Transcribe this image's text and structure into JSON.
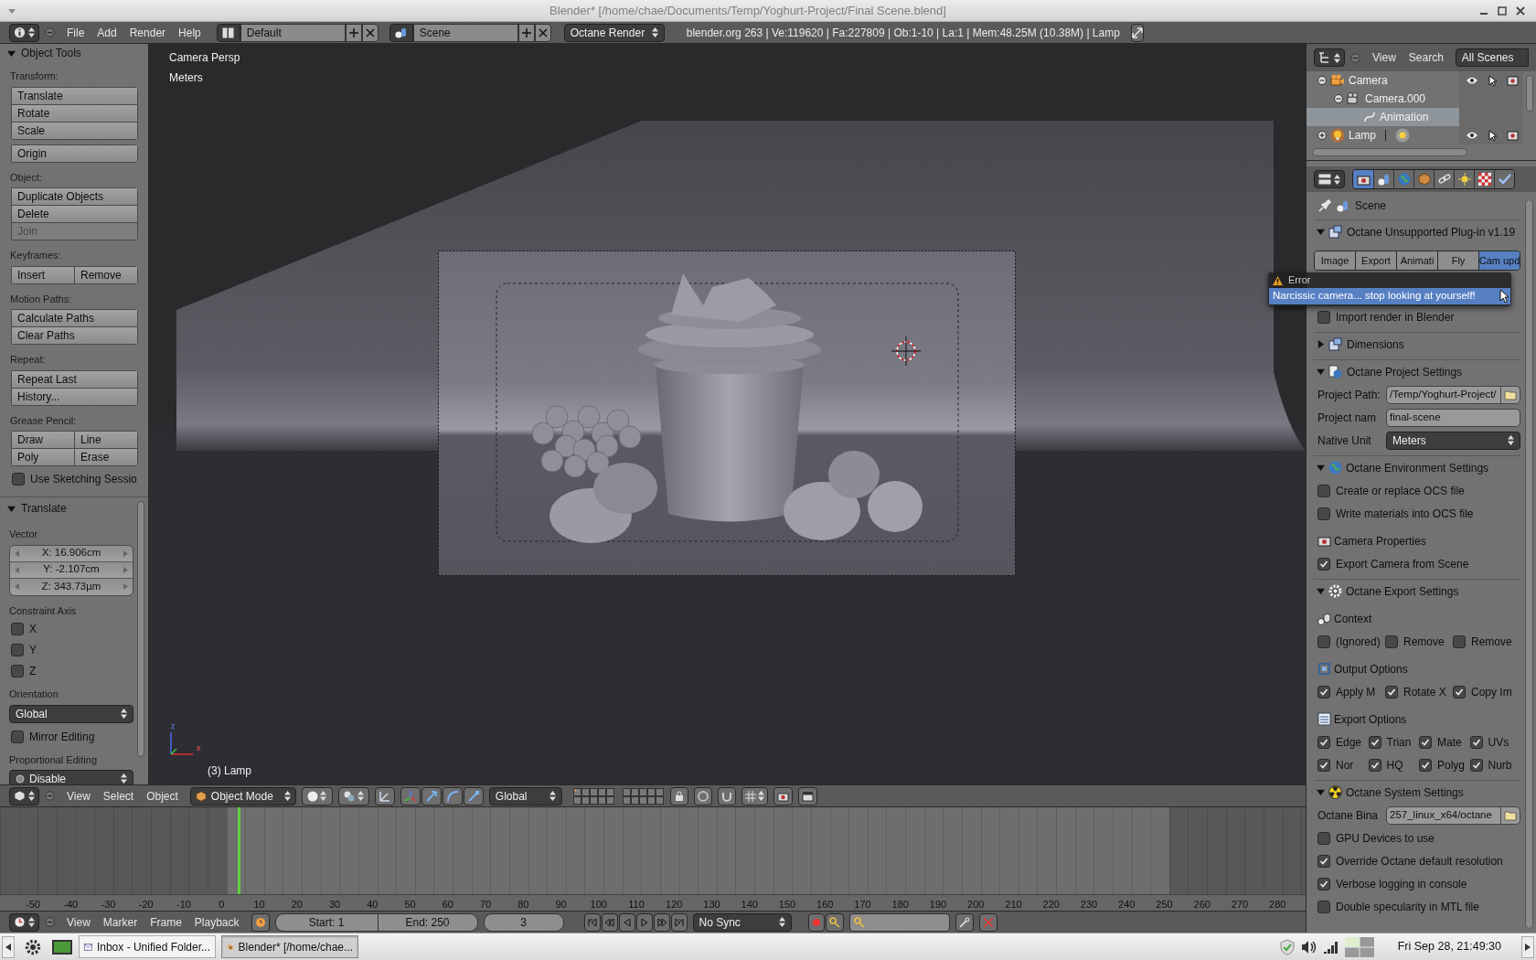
{
  "window": {
    "title": "Blender* [/home/chae/Documents/Temp/Yoghurt-Project/Final Scene.blend]"
  },
  "info_header": {
    "menus": [
      "File",
      "Add",
      "Render",
      "Help"
    ],
    "layout": "Default",
    "scene": "Scene",
    "engine": "Octane Render",
    "stats": "blender.org 263 | Ve:119620 | Fa:227809 | Ob:1-10 | La:1 | Mem:48.25M (10.38M) | Lamp"
  },
  "tool_shelf": {
    "title": "Object Tools",
    "expanded": true,
    "groups": [
      {
        "label": "Transform:",
        "rows": [
          [
            {
              "label": "Translate",
              "disabled": false
            }
          ],
          [
            {
              "label": "Rotate",
              "disabled": false
            }
          ],
          [
            {
              "label": "Scale",
              "disabled": false
            }
          ]
        ]
      },
      {
        "rows": [
          [
            {
              "label": "Origin",
              "disabled": false
            }
          ]
        ]
      },
      {
        "label": "Object:",
        "rows": [
          [
            {
              "label": "Duplicate Objects",
              "disabled": false
            }
          ],
          [
            {
              "label": "Delete",
              "disabled": false
            }
          ],
          [
            {
              "label": "Join",
              "disabled": true
            }
          ]
        ]
      },
      {
        "label": "Keyframes:",
        "rows": [
          [
            {
              "label": "Insert",
              "disabled": false
            },
            {
              "label": "Remove",
              "disabled": false
            }
          ]
        ]
      },
      {
        "label": "Motion Paths:",
        "rows": [
          [
            {
              "label": "Calculate Paths",
              "disabled": false
            }
          ],
          [
            {
              "label": "Clear Paths",
              "disabled": false
            }
          ]
        ]
      },
      {
        "label": "Repeat:",
        "rows": [
          [
            {
              "label": "Repeat Last",
              "disabled": false
            }
          ],
          [
            {
              "label": "History...",
              "disabled": false
            }
          ]
        ]
      },
      {
        "label": "Grease Pencil:",
        "rows": [
          [
            {
              "label": "Draw",
              "disabled": false
            },
            {
              "label": "Line",
              "disabled": false
            }
          ],
          [
            {
              "label": "Poly",
              "disabled": false
            },
            {
              "label": "Erase",
              "disabled": false
            }
          ]
        ]
      }
    ],
    "sketching": {
      "label": "Use Sketching Sessio",
      "checked": false
    }
  },
  "operator_panel": {
    "title": "Translate",
    "expanded": true,
    "vector_label": "Vector",
    "vector": [
      "X: 16.906cm",
      "Y: -2.107cm",
      "Z: 343.73µm"
    ],
    "constraint_label": "Constraint Axis",
    "axes": [
      {
        "label": "X",
        "checked": false
      },
      {
        "label": "Y",
        "checked": false
      },
      {
        "label": "Z",
        "checked": false
      }
    ],
    "orientation_label": "Orientation",
    "orientation": "Global",
    "mirror": {
      "label": "Mirror Editing",
      "checked": false
    },
    "proportional_label": "Proportional Editing",
    "proportional": "Disable"
  },
  "viewport": {
    "view_name": "Camera Persp",
    "units": "Meters",
    "axis_labels": [
      "z",
      "x"
    ],
    "object_info": "(3) Lamp"
  },
  "view3d_header": {
    "menus": [
      "View",
      "Select",
      "Object"
    ],
    "mode": "Object Mode",
    "orientation": "Global"
  },
  "timeline": {
    "ruler": [
      "-50",
      "-40",
      "-30",
      "-20",
      "-10",
      "0",
      "10",
      "20",
      "30",
      "40",
      "50",
      "60",
      "70",
      "80",
      "90",
      "100",
      "110",
      "120",
      "130",
      "140",
      "150",
      "160",
      "170",
      "180",
      "190",
      "200",
      "210",
      "220",
      "230",
      "240",
      "250",
      "260",
      "270",
      "280"
    ],
    "playhead": {
      "level": 0.182
    },
    "menus": [
      "View",
      "Marker",
      "Frame",
      "Playback"
    ],
    "start": "Start: 1",
    "end": "End: 250",
    "current": "3",
    "sync": "No Sync"
  },
  "outliner": {
    "menus": [
      "View",
      "Search"
    ],
    "filter": "All Scenes",
    "items": [
      {
        "label": "Camera",
        "kind": "camera",
        "expanded": true,
        "selected": false,
        "children": [
          {
            "label": "Camera.000",
            "kind": "camera_data",
            "expanded": true,
            "selected": false,
            "children": [
              {
                "label": "Animation",
                "kind": "animation",
                "selected": true
              }
            ]
          }
        ]
      },
      {
        "label": "Lamp",
        "kind": "lamp",
        "expanded": false,
        "selected": false
      }
    ]
  },
  "properties": {
    "context_tabs": [
      {
        "selected": true
      },
      {
        "selected": false
      },
      {
        "selected": false
      },
      {
        "selected": false
      },
      {
        "selected": false
      },
      {
        "selected": false
      },
      {
        "selected": false
      },
      {
        "selected": false
      }
    ],
    "breadcrumb": "Scene",
    "panels": [
      {
        "title": "Octane Unsupported Plug-in v1.19",
        "kind": "plugin",
        "expanded": true,
        "items": [
          {
            "kind": "tabs",
            "tabs": [
              {
                "label": "Image",
                "selected": false
              },
              {
                "label": "Export",
                "selected": false
              },
              {
                "label": "Animati",
                "selected": false
              },
              {
                "label": "Fly",
                "selected": false
              },
              {
                "label": "Cam upd",
                "selected": true
              }
            ]
          },
          {
            "kind": "spacer"
          },
          {
            "kind": "checkbox",
            "label": "Import render in Blender",
            "checked": false
          }
        ]
      },
      {
        "title": "Dimensions",
        "kind": "plugin",
        "expanded": false
      },
      {
        "title": "Octane Project Settings",
        "kind": "project",
        "expanded": true,
        "items": [
          {
            "kind": "path",
            "label": "Project Path:",
            "value": "/Temp/Yoghurt-Project/"
          },
          {
            "kind": "text",
            "label": "Project nam",
            "value": "final-scene"
          },
          {
            "kind": "dropdown",
            "label": "Native Unit",
            "value": "Meters"
          }
        ]
      },
      {
        "title": "Octane Environment Settings",
        "kind": "environment",
        "expanded": true,
        "items": [
          {
            "kind": "checkbox",
            "label": "Create or replace OCS file",
            "checked": false
          },
          {
            "kind": "checkbox",
            "label": "Write materials into OCS file",
            "checked": false
          },
          {
            "kind": "heading",
            "label": "Camera Properties"
          },
          {
            "kind": "checkbox",
            "label": "Export Camera from Scene",
            "checked": true
          }
        ]
      },
      {
        "title": "Octane Export Settings",
        "kind": "export",
        "expanded": true,
        "items": [
          {
            "kind": "heading",
            "label": "Context"
          },
          {
            "kind": "checkrow",
            "checks": [
              {
                "label": "(Ignored)",
                "checked": false
              },
              {
                "label": "Remove",
                "checked": false
              },
              {
                "label": "Remove",
                "checked": false
              }
            ]
          },
          {
            "kind": "heading",
            "label": "Output Options"
          },
          {
            "kind": "checkrow",
            "checks": [
              {
                "label": "Apply M",
                "checked": true
              },
              {
                "label": "Rotate X",
                "checked": true
              },
              {
                "label": "Copy Im",
                "checked": true
              }
            ]
          },
          {
            "kind": "heading",
            "label": "Export Options"
          },
          {
            "kind": "checkrow",
            "checks": [
              {
                "label": "Edge",
                "checked": true
              },
              {
                "label": "Trian",
                "checked": true
              },
              {
                "label": "Mate",
                "checked": true
              },
              {
                "label": "UVs",
                "checked": true
              }
            ]
          },
          {
            "kind": "checkrow",
            "checks": [
              {
                "label": "Nor",
                "checked": true
              },
              {
                "label": "HQ",
                "checked": true
              },
              {
                "label": "Polyg",
                "checked": true
              },
              {
                "label": "Nurb",
                "checked": true
              }
            ]
          }
        ]
      },
      {
        "title": "Octane System Settings",
        "kind": "system",
        "expanded": true,
        "items": [
          {
            "kind": "path",
            "label": "Octane Bina",
            "value": "257_linux_x64/octane"
          },
          {
            "kind": "checkbox",
            "label": "GPU Devices to use",
            "checked": false
          },
          {
            "kind": "checkbox",
            "label": "Override Octane default resolution",
            "checked": true
          },
          {
            "kind": "checkbox",
            "label": "Verbose logging in console",
            "checked": true
          },
          {
            "kind": "checkbox",
            "label": "Double specularity in MTL file",
            "checked": false
          }
        ]
      }
    ]
  },
  "error_popup": {
    "title": "Error",
    "message": "Narcissic camera... stop looking at yourself!"
  },
  "taskbar": {
    "tasks": [
      {
        "label": "Inbox - Unified Folder...",
        "selected": false
      },
      {
        "label": "Blender* [/home/chae...",
        "selected": true
      }
    ],
    "clock": "Fri Sep 28, 21:49:30"
  }
}
